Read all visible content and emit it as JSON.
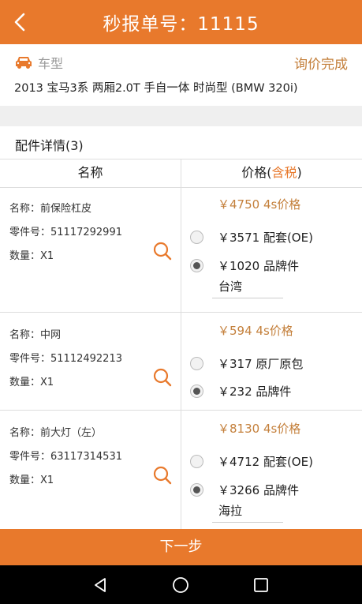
{
  "header": {
    "title": "秒报单号：11115"
  },
  "car": {
    "label": "车型",
    "status": "询价完成",
    "description": "2013 宝马3系 两厢2.0T 手自一体 时尚型 (BMW 320i)"
  },
  "parts": {
    "title": "配件详情(3)",
    "col_name": "名称",
    "col_price": "价格(",
    "col_price_tax": "含税",
    "col_price_end": ")",
    "items": [
      {
        "name": "名称：前保险杠皮",
        "part_no": "零件号：51117292991",
        "qty": "数量：X1",
        "price_4s": "￥4750 4s价格",
        "options": [
          {
            "text": "￥3571 配套(OE)",
            "selected": false
          },
          {
            "text": "￥1020 品牌件",
            "selected": true
          }
        ],
        "brand": "台湾"
      },
      {
        "name": "名称：中网",
        "part_no": "零件号：51112492213",
        "qty": "数量：X1",
        "price_4s": "￥594 4s价格",
        "options": [
          {
            "text": "￥317 原厂原包",
            "selected": false
          },
          {
            "text": "￥232 品牌件",
            "selected": true
          }
        ]
      },
      {
        "name": "名称：前大灯（左）",
        "part_no": "零件号：63117314531",
        "qty": "数量：X1",
        "price_4s": "￥8130 4s价格",
        "options": [
          {
            "text": "￥4712 配套(OE)",
            "selected": false
          },
          {
            "text": "￥3266 品牌件",
            "selected": true
          }
        ],
        "brand": "海拉"
      }
    ]
  },
  "footer": {
    "next_label": "下一步"
  },
  "colors": {
    "accent": "#e8792c",
    "price_4s": "#c4803c"
  }
}
